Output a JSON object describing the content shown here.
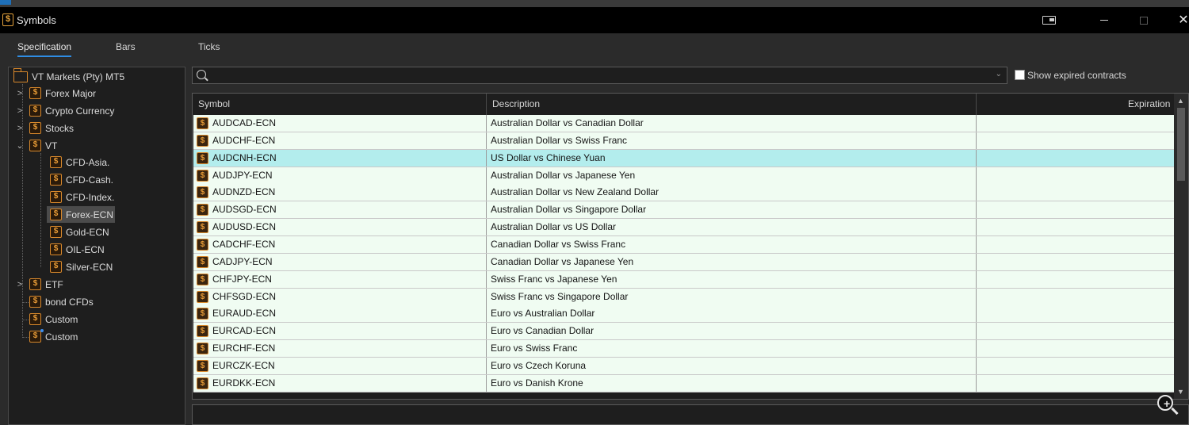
{
  "window": {
    "title": "Symbols"
  },
  "tabs": [
    {
      "label": "Specification",
      "active": true
    },
    {
      "label": "Bars",
      "active": false
    },
    {
      "label": "Ticks",
      "active": false
    }
  ],
  "tree": {
    "root": "VT Markets (Pty) MT5",
    "items": [
      {
        "label": "Forex Major",
        "expandable": true,
        "expanded": false,
        "level": 1
      },
      {
        "label": "Crypto Currency",
        "expandable": true,
        "expanded": false,
        "level": 1
      },
      {
        "label": "Stocks",
        "expandable": true,
        "expanded": false,
        "level": 1
      },
      {
        "label": "VT",
        "expandable": true,
        "expanded": true,
        "level": 1
      },
      {
        "label": "CFD-Asia.",
        "level": 2
      },
      {
        "label": "CFD-Cash.",
        "level": 2
      },
      {
        "label": "CFD-Index.",
        "level": 2
      },
      {
        "label": "Forex-ECN",
        "level": 2,
        "selected": true
      },
      {
        "label": "Gold-ECN",
        "level": 2
      },
      {
        "label": "OIL-ECN",
        "level": 2
      },
      {
        "label": "Silver-ECN",
        "level": 2
      },
      {
        "label": "ETF",
        "expandable": true,
        "expanded": false,
        "level": 1
      },
      {
        "label": "bond CFDs",
        "level": 1
      },
      {
        "label": "Custom",
        "level": 1
      },
      {
        "label": "Custom",
        "level": 1,
        "badge": true
      }
    ]
  },
  "search": {
    "value": "",
    "placeholder": ""
  },
  "show_expired": {
    "label": "Show expired contracts",
    "checked": false
  },
  "table": {
    "columns": [
      "Symbol",
      "Description",
      "Expiration"
    ],
    "rows": [
      {
        "symbol": "AUDCAD-ECN",
        "description": "Australian Dollar vs Canadian Dollar",
        "expiration": ""
      },
      {
        "symbol": "AUDCHF-ECN",
        "description": "Australian Dollar vs Swiss Franc",
        "expiration": ""
      },
      {
        "symbol": "AUDCNH-ECN",
        "description": "US Dollar vs Chinese Yuan",
        "expiration": "",
        "selected": true
      },
      {
        "symbol": "AUDJPY-ECN",
        "description": "Australian Dollar vs Japanese Yen",
        "expiration": ""
      },
      {
        "symbol": "AUDNZD-ECN",
        "description": "Australian Dollar vs New Zealand Dollar",
        "expiration": ""
      },
      {
        "symbol": "AUDSGD-ECN",
        "description": "Australian Dollar vs Singapore Dollar",
        "expiration": ""
      },
      {
        "symbol": "AUDUSD-ECN",
        "description": "Australian Dollar vs US Dollar",
        "expiration": ""
      },
      {
        "symbol": "CADCHF-ECN",
        "description": "Canadian Dollar vs Swiss Franc",
        "expiration": ""
      },
      {
        "symbol": "CADJPY-ECN",
        "description": "Canadian Dollar vs Japanese Yen",
        "expiration": ""
      },
      {
        "symbol": "CHFJPY-ECN",
        "description": "Swiss Franc vs Japanese Yen",
        "expiration": ""
      },
      {
        "symbol": "CHFSGD-ECN",
        "description": "Swiss Franc vs Singapore Dollar",
        "expiration": ""
      },
      {
        "symbol": "EURAUD-ECN",
        "description": "Euro vs Australian Dollar",
        "expiration": ""
      },
      {
        "symbol": "EURCAD-ECN",
        "description": "Euro vs Canadian Dollar",
        "expiration": ""
      },
      {
        "symbol": "EURCHF-ECN",
        "description": "Euro vs Swiss Franc",
        "expiration": ""
      },
      {
        "symbol": "EURCZK-ECN",
        "description": "Euro vs Czech Koruna",
        "expiration": ""
      },
      {
        "symbol": "EURDKK-ECN",
        "description": "Euro vs Danish Krone",
        "expiration": ""
      }
    ]
  },
  "icons": {
    "app": "dollar-symbol-icon",
    "tree_group": "dollar-symbol-icon",
    "root": "folder-icon",
    "search": "search-icon",
    "zoom": "zoom-in-icon"
  },
  "colors": {
    "row_bg": "#f0fcf2",
    "row_selected_bg": "#b3eded",
    "accent": "#2f8de4",
    "coin": "#d8882b"
  }
}
